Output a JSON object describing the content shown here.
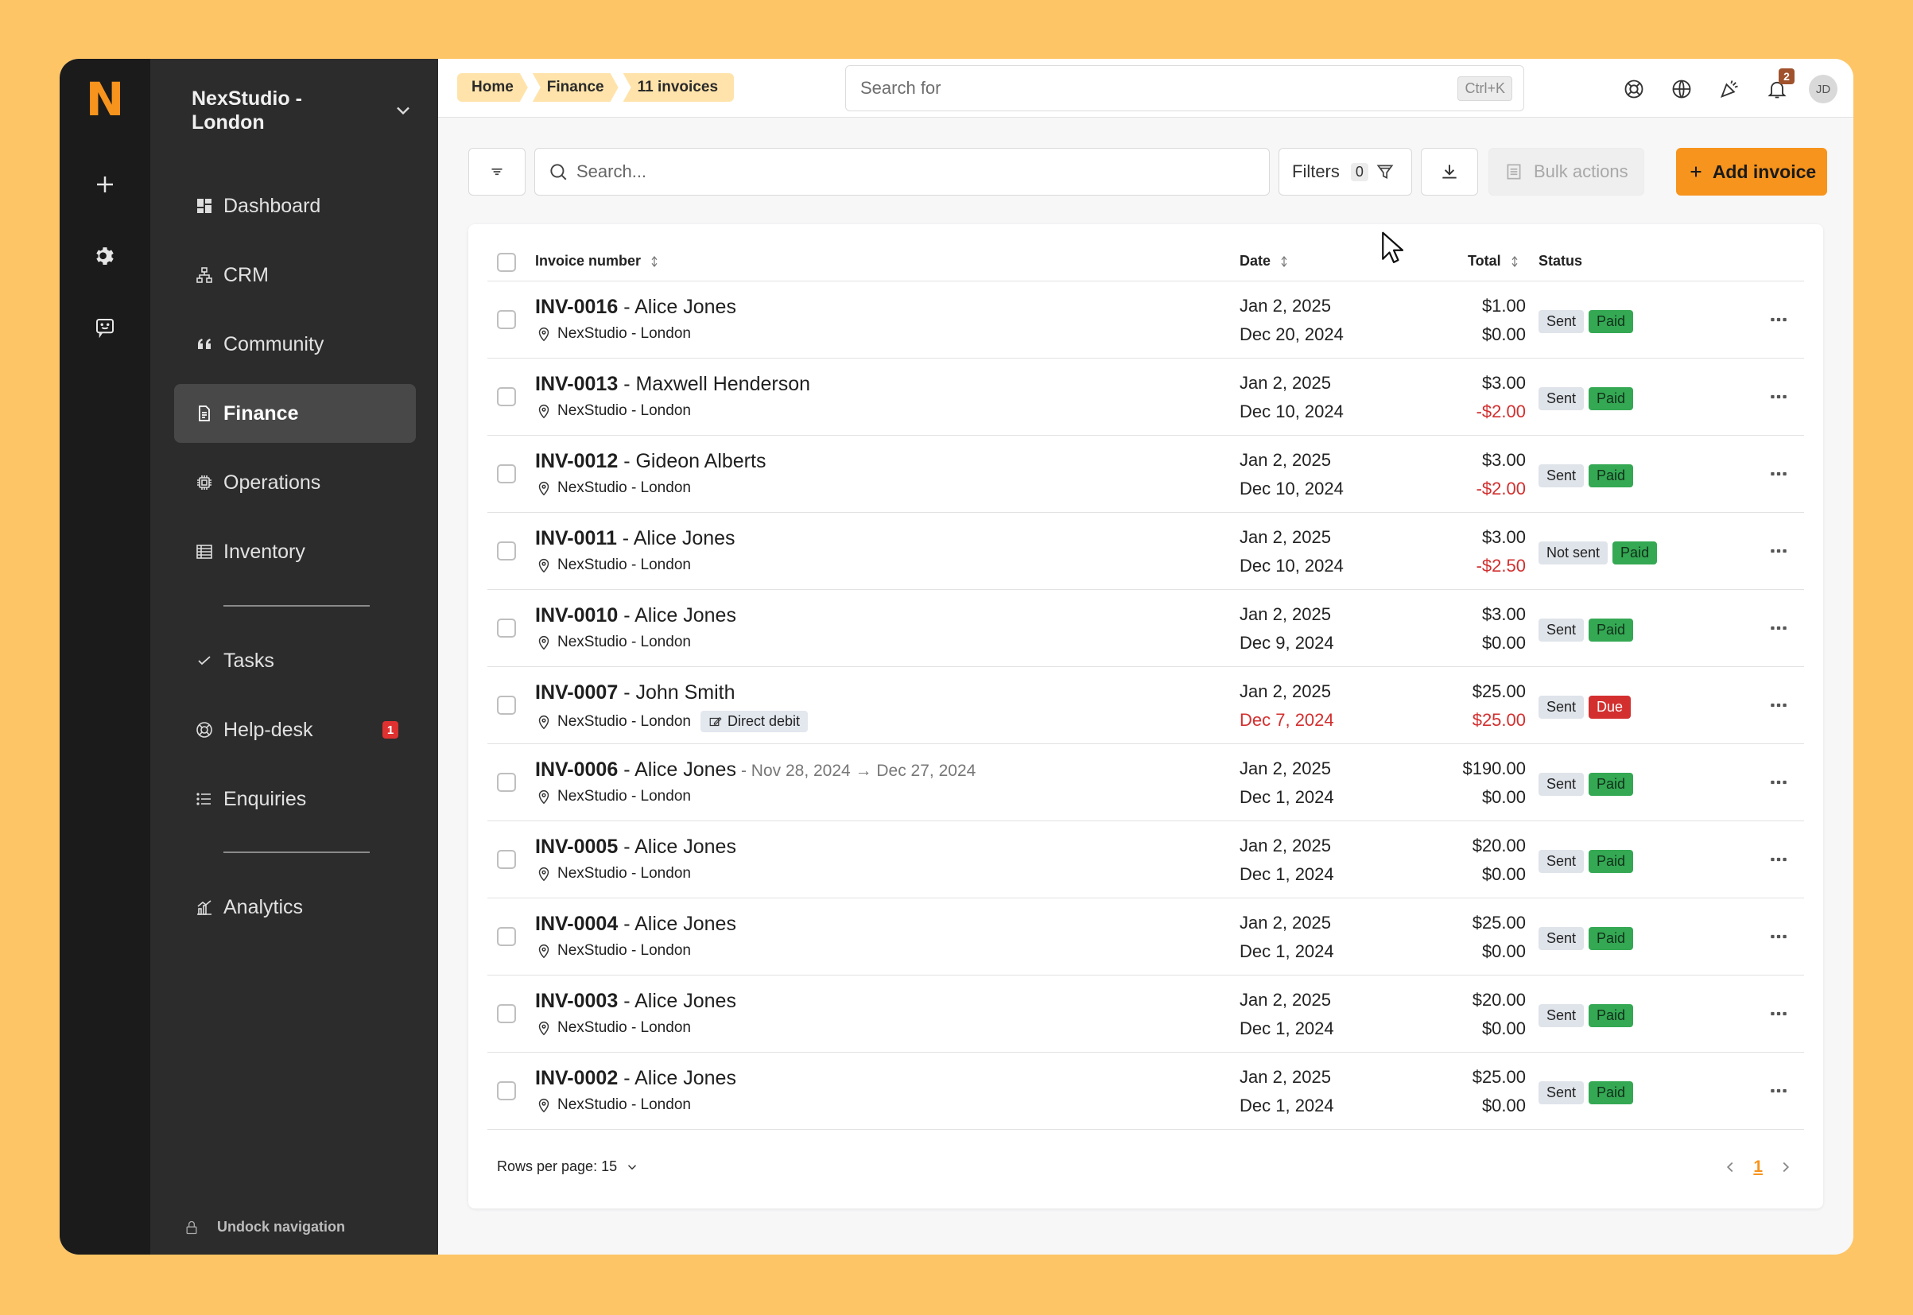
{
  "brand": {
    "logo": "N",
    "accent": "#F7941D"
  },
  "sidebar": {
    "workspace": "NexStudio - London",
    "items": [
      {
        "label": "Dashboard",
        "icon": "dashboard-icon"
      },
      {
        "label": "CRM",
        "icon": "hierarchy-icon"
      },
      {
        "label": "Community",
        "icon": "quote-icon"
      },
      {
        "label": "Finance",
        "icon": "document-icon",
        "active": true
      },
      {
        "label": "Operations",
        "icon": "chip-icon"
      },
      {
        "label": "Inventory",
        "icon": "list-table-icon"
      },
      {
        "label": "Tasks",
        "icon": "check-icon"
      },
      {
        "label": "Help-desk",
        "icon": "lifebuoy-icon",
        "badge": "1"
      },
      {
        "label": "Enquiries",
        "icon": "list-icon"
      },
      {
        "label": "Analytics",
        "icon": "chart-icon"
      }
    ],
    "undock": "Undock navigation"
  },
  "topbar": {
    "breadcrumbs": [
      "Home",
      "Finance",
      "11 invoices"
    ],
    "search_placeholder": "Search for",
    "shortcut": "Ctrl+K",
    "notifications": "2",
    "avatar": "JD"
  },
  "toolbar": {
    "search_placeholder": "Search...",
    "filters_label": "Filters",
    "filters_count": "0",
    "bulk_label": "Bulk actions",
    "add_label": "Add invoice"
  },
  "table": {
    "headers": {
      "invoice": "Invoice number",
      "date": "Date",
      "total": "Total",
      "status": "Status"
    },
    "rows": [
      {
        "num": "INV-0016",
        "sep": " - ",
        "name": "Alice Jones",
        "range": "",
        "location": "NexStudio - London",
        "tag": "",
        "date1": "Jan 2, 2025",
        "date2": "Dec 20, 2024",
        "date2_red": false,
        "total": "$1.00",
        "balance": "$0.00",
        "balance_red": false,
        "sent": "Sent",
        "pay": "Paid",
        "pay_state": "paid"
      },
      {
        "num": "INV-0013",
        "sep": " - ",
        "name": "Maxwell Henderson",
        "range": "",
        "location": "NexStudio - London",
        "tag": "",
        "date1": "Jan 2, 2025",
        "date2": "Dec 10, 2024",
        "date2_red": false,
        "total": "$3.00",
        "balance": "-$2.00",
        "balance_red": true,
        "sent": "Sent",
        "pay": "Paid",
        "pay_state": "paid"
      },
      {
        "num": "INV-0012",
        "sep": " - ",
        "name": "Gideon Alberts",
        "range": "",
        "location": "NexStudio - London",
        "tag": "",
        "date1": "Jan 2, 2025",
        "date2": "Dec 10, 2024",
        "date2_red": false,
        "total": "$3.00",
        "balance": "-$2.00",
        "balance_red": true,
        "sent": "Sent",
        "pay": "Paid",
        "pay_state": "paid"
      },
      {
        "num": "INV-0011",
        "sep": " - ",
        "name": "Alice Jones",
        "range": "",
        "location": "NexStudio - London",
        "tag": "",
        "date1": "Jan 2, 2025",
        "date2": "Dec 10, 2024",
        "date2_red": false,
        "total": "$3.00",
        "balance": "-$2.50",
        "balance_red": true,
        "sent": "Not sent",
        "pay": "Paid",
        "pay_state": "paid"
      },
      {
        "num": "INV-0010",
        "sep": " - ",
        "name": "Alice Jones",
        "range": "",
        "location": "NexStudio - London",
        "tag": "",
        "date1": "Jan 2, 2025",
        "date2": "Dec 9, 2024",
        "date2_red": false,
        "total": "$3.00",
        "balance": "$0.00",
        "balance_red": false,
        "sent": "Sent",
        "pay": "Paid",
        "pay_state": "paid"
      },
      {
        "num": "INV-0007",
        "sep": " - ",
        "name": "John Smith",
        "range": "",
        "location": "NexStudio - London",
        "tag": "Direct debit",
        "date1": "Jan 2, 2025",
        "date2": "Dec 7, 2024",
        "date2_red": true,
        "total": "$25.00",
        "balance": "$25.00",
        "balance_red": true,
        "sent": "Sent",
        "pay": "Due",
        "pay_state": "due"
      },
      {
        "num": "INV-0006",
        "sep": " - ",
        "name": "Alice Jones",
        "range": "- Nov 28, 2024 → Dec 27, 2024",
        "location": "NexStudio - London",
        "tag": "",
        "date1": "Jan 2, 2025",
        "date2": "Dec 1, 2024",
        "date2_red": false,
        "total": "$190.00",
        "balance": "$0.00",
        "balance_red": false,
        "sent": "Sent",
        "pay": "Paid",
        "pay_state": "paid"
      },
      {
        "num": "INV-0005",
        "sep": " - ",
        "name": "Alice Jones",
        "range": "",
        "location": "NexStudio - London",
        "tag": "",
        "date1": "Jan 2, 2025",
        "date2": "Dec 1, 2024",
        "date2_red": false,
        "total": "$20.00",
        "balance": "$0.00",
        "balance_red": false,
        "sent": "Sent",
        "pay": "Paid",
        "pay_state": "paid"
      },
      {
        "num": "INV-0004",
        "sep": " - ",
        "name": "Alice Jones",
        "range": "",
        "location": "NexStudio - London",
        "tag": "",
        "date1": "Jan 2, 2025",
        "date2": "Dec 1, 2024",
        "date2_red": false,
        "total": "$25.00",
        "balance": "$0.00",
        "balance_red": false,
        "sent": "Sent",
        "pay": "Paid",
        "pay_state": "paid"
      },
      {
        "num": "INV-0003",
        "sep": " - ",
        "name": "Alice Jones",
        "range": "",
        "location": "NexStudio - London",
        "tag": "",
        "date1": "Jan 2, 2025",
        "date2": "Dec 1, 2024",
        "date2_red": false,
        "total": "$20.00",
        "balance": "$0.00",
        "balance_red": false,
        "sent": "Sent",
        "pay": "Paid",
        "pay_state": "paid"
      },
      {
        "num": "INV-0002",
        "sep": " - ",
        "name": "Alice Jones",
        "range": "",
        "location": "NexStudio - London",
        "tag": "",
        "date1": "Jan 2, 2025",
        "date2": "Dec 1, 2024",
        "date2_red": false,
        "total": "$25.00",
        "balance": "$0.00",
        "balance_red": false,
        "sent": "Sent",
        "pay": "Paid",
        "pay_state": "paid"
      }
    ],
    "rows_per_page": "Rows per page: 15",
    "page": "1"
  }
}
